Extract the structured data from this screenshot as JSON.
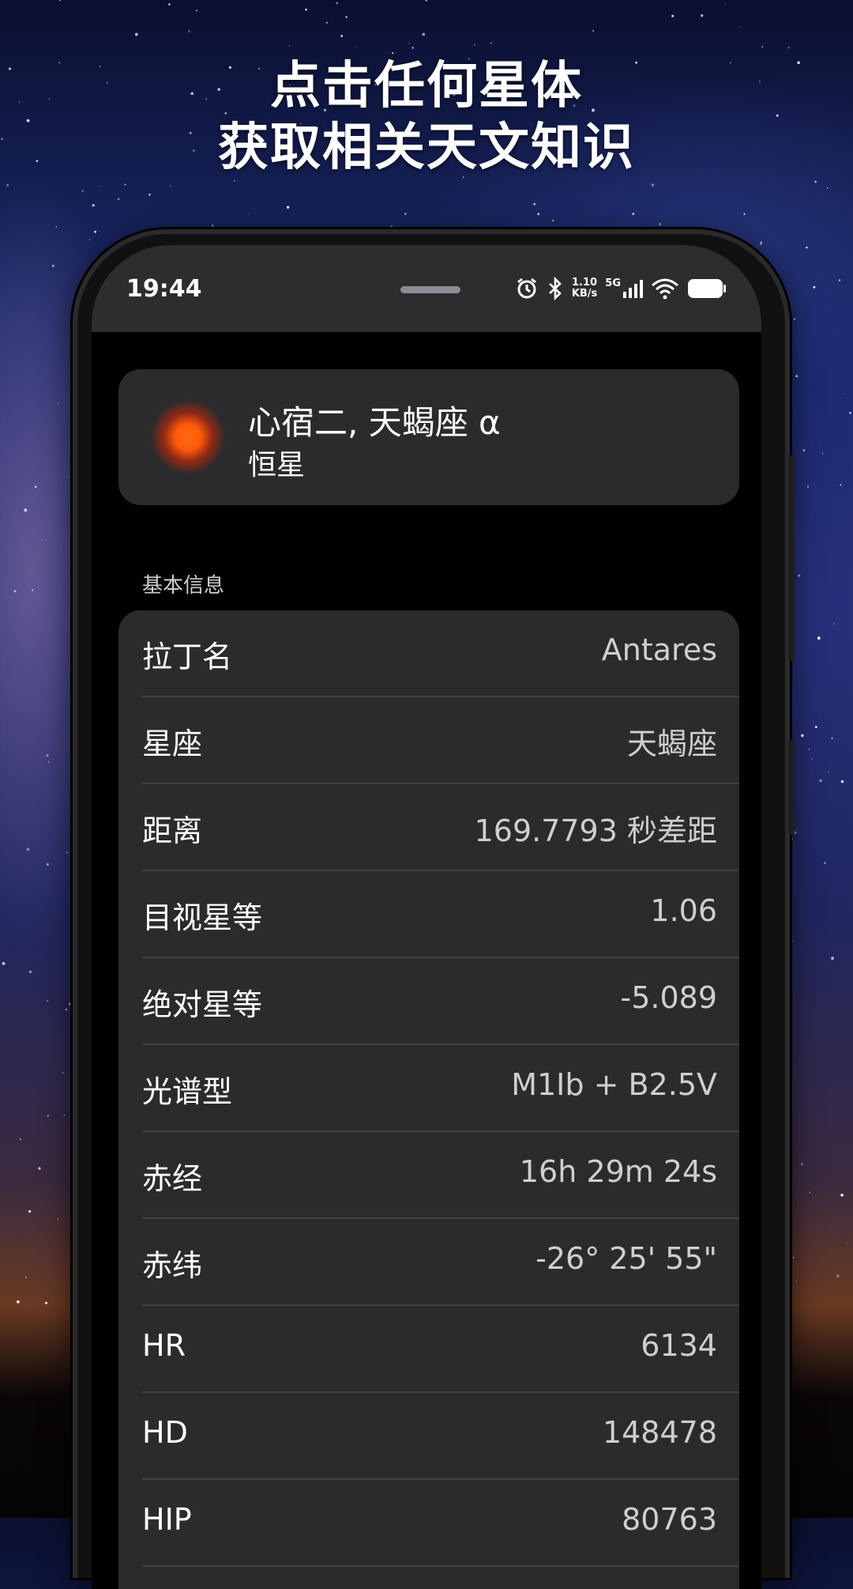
{
  "promo": {
    "line1": "点击任何星体",
    "line2": "获取相关天文知识"
  },
  "status_bar": {
    "time": "19:44",
    "net_speed_value": "1.10",
    "net_speed_unit": "KB/s",
    "network": "5G",
    "icons": [
      "alarm-icon",
      "bluetooth-icon",
      "signal-icon",
      "wifi-icon",
      "battery-icon"
    ]
  },
  "object": {
    "name": "心宿二, 天蝎座 α",
    "type": "恒星",
    "color": "#ff5a0a"
  },
  "section": {
    "label": "基本信息"
  },
  "info_rows": [
    {
      "key": "拉丁名",
      "value": "Antares"
    },
    {
      "key": "星座",
      "value": "天蝎座"
    },
    {
      "key": "距离",
      "value": "169.7793 秒差距"
    },
    {
      "key": "目视星等",
      "value": "1.06"
    },
    {
      "key": "绝对星等",
      "value": "-5.089"
    },
    {
      "key": "光谱型",
      "value": "M1Ib + B2.5V"
    },
    {
      "key": "赤经",
      "value": "16h 29m 24s"
    },
    {
      "key": "赤纬",
      "value": "-26° 25' 55\""
    },
    {
      "key": "HR",
      "value": "6134"
    },
    {
      "key": "HD",
      "value": "148478"
    },
    {
      "key": "HIP",
      "value": "80763"
    }
  ]
}
